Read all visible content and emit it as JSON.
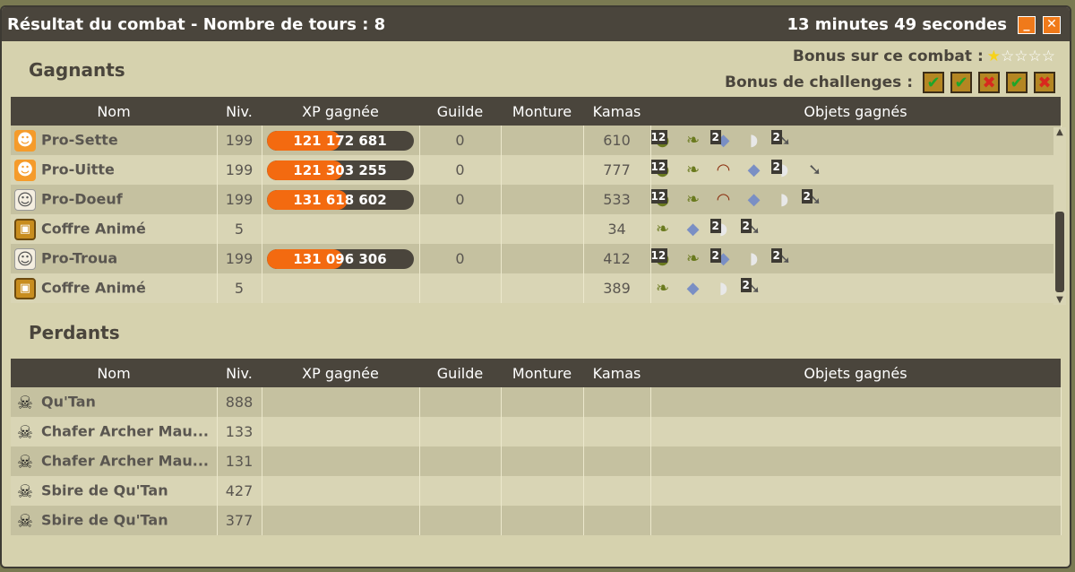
{
  "window": {
    "title": "Résultat du combat - Nombre de tours : 8",
    "duration": "13 minutes 49 secondes",
    "minimize_glyph": "_",
    "close_glyph": "✕"
  },
  "bonus": {
    "combat_label": "Bonus sur ce combat :",
    "stars_total": 5,
    "stars_on": 1,
    "challenges_label": "Bonus de challenges :",
    "challenges": [
      "ok",
      "ok",
      "ko",
      "ok",
      "ko"
    ]
  },
  "columns": {
    "nom": "Nom",
    "niv": "Niv.",
    "xp": "XP gagnée",
    "guilde": "Guilde",
    "monture": "Monture",
    "kamas": "Kamas",
    "objets": "Objets gagnés"
  },
  "winners": {
    "title": "Gagnants",
    "rows": [
      {
        "name": "Pro-Sette",
        "avatar": "iop-icon",
        "level": "199",
        "xp": "121 172 681",
        "xp_fill": 0.5,
        "guild": "0",
        "kamas": "610",
        "items": [
          [
            "dofus-icon",
            "12"
          ],
          [
            "horn-icon",
            ""
          ],
          [
            "gem-icon",
            "2"
          ],
          [
            "tooth-icon",
            ""
          ],
          [
            "arrow-icon",
            "2"
          ]
        ]
      },
      {
        "name": "Pro-Uitte",
        "avatar": "iop-icon",
        "level": "199",
        "xp": "121 303 255",
        "xp_fill": 0.52,
        "guild": "0",
        "kamas": "777",
        "items": [
          [
            "dofus-icon",
            "12"
          ],
          [
            "horn-icon",
            ""
          ],
          [
            "claw-icon",
            ""
          ],
          [
            "gem-icon",
            ""
          ],
          [
            "tooth-icon",
            "2"
          ],
          [
            "arrow-icon",
            ""
          ]
        ]
      },
      {
        "name": "Pro-Doeuf",
        "avatar": "eniripsa-icon",
        "level": "199",
        "xp": "131 618 602",
        "xp_fill": 0.55,
        "guild": "0",
        "kamas": "533",
        "items": [
          [
            "dofus-icon",
            "12"
          ],
          [
            "horn-icon",
            ""
          ],
          [
            "claw-icon",
            ""
          ],
          [
            "gem-icon",
            ""
          ],
          [
            "tooth-icon",
            ""
          ],
          [
            "arrow-icon",
            "2"
          ]
        ]
      },
      {
        "name": "Coffre Animé",
        "avatar": "chest-icon",
        "level": "5",
        "xp": "",
        "xp_fill": null,
        "guild": "",
        "kamas": "34",
        "items": [
          [
            "horn-icon",
            ""
          ],
          [
            "gem-icon",
            ""
          ],
          [
            "tooth-icon",
            "2"
          ],
          [
            "arrow-icon",
            "2"
          ]
        ]
      },
      {
        "name": "Pro-Troua",
        "avatar": "eniripsa-icon",
        "level": "199",
        "xp": "131 096 306",
        "xp_fill": 0.52,
        "guild": "0",
        "kamas": "412",
        "items": [
          [
            "dofus-icon",
            "12"
          ],
          [
            "horn-icon",
            ""
          ],
          [
            "gem-icon",
            "2"
          ],
          [
            "tooth-icon",
            ""
          ],
          [
            "arrow-icon",
            "2"
          ]
        ]
      },
      {
        "name": "Coffre Animé",
        "avatar": "chest-icon",
        "level": "5",
        "xp": "",
        "xp_fill": null,
        "guild": "",
        "kamas": "389",
        "items": [
          [
            "horn-icon",
            ""
          ],
          [
            "gem-icon",
            ""
          ],
          [
            "tooth-icon",
            ""
          ],
          [
            "arrow-icon",
            "2"
          ]
        ]
      }
    ]
  },
  "losers": {
    "title": "Perdants",
    "rows": [
      {
        "name": "Qu'Tan",
        "avatar": "skull-icon",
        "level": "888"
      },
      {
        "name": "Chafer Archer Mau...",
        "avatar": "skull-icon",
        "level": "133"
      },
      {
        "name": "Chafer Archer Mau...",
        "avatar": "skull-icon",
        "level": "131"
      },
      {
        "name": "Sbire de Qu'Tan",
        "avatar": "skull-icon",
        "level": "427"
      },
      {
        "name": "Sbire de Qu'Tan",
        "avatar": "skull-icon",
        "level": "377"
      }
    ]
  }
}
